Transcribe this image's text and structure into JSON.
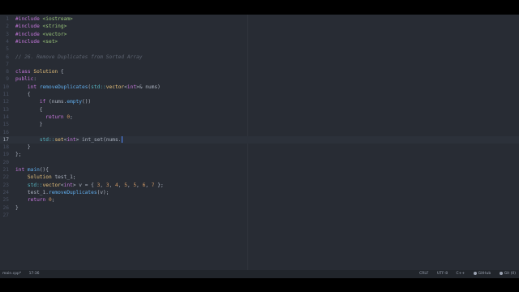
{
  "editor": {
    "lines": [
      {
        "n": "1",
        "segs": [
          {
            "t": "#include ",
            "c": "tok-pp"
          },
          {
            "t": "<iostream>",
            "c": "tok-inc"
          }
        ]
      },
      {
        "n": "2",
        "segs": [
          {
            "t": "#include ",
            "c": "tok-pp"
          },
          {
            "t": "<string>",
            "c": "tok-inc"
          }
        ]
      },
      {
        "n": "3",
        "segs": [
          {
            "t": "#include ",
            "c": "tok-pp"
          },
          {
            "t": "<vector>",
            "c": "tok-inc"
          }
        ]
      },
      {
        "n": "4",
        "segs": [
          {
            "t": "#include ",
            "c": "tok-pp"
          },
          {
            "t": "<set>",
            "c": "tok-inc"
          }
        ]
      },
      {
        "n": "5",
        "segs": []
      },
      {
        "n": "6",
        "segs": [
          {
            "t": "// 26. Remove Duplicates from Sorted Array",
            "c": "tok-cm"
          }
        ]
      },
      {
        "n": "7",
        "segs": []
      },
      {
        "n": "8",
        "segs": [
          {
            "t": "class ",
            "c": "tok-kw"
          },
          {
            "t": "Solution",
            "c": "tok-ty"
          },
          {
            "t": " {",
            "c": ""
          }
        ]
      },
      {
        "n": "9",
        "segs": [
          {
            "t": "public",
            "c": "tok-kw"
          },
          {
            "t": ":",
            "c": ""
          }
        ]
      },
      {
        "n": "10",
        "segs": [
          {
            "t": "    ",
            "c": ""
          },
          {
            "t": "int ",
            "c": "tok-kw"
          },
          {
            "t": "removeDuplicates",
            "c": "tok-fn"
          },
          {
            "t": "(",
            "c": ""
          },
          {
            "t": "std::",
            "c": "tok-ns"
          },
          {
            "t": "vector",
            "c": "tok-ty"
          },
          {
            "t": "<",
            "c": ""
          },
          {
            "t": "int",
            "c": "tok-kw"
          },
          {
            "t": ">& nums)",
            "c": ""
          }
        ]
      },
      {
        "n": "11",
        "segs": [
          {
            "t": "    {",
            "c": ""
          }
        ]
      },
      {
        "n": "12",
        "segs": [
          {
            "t": "        ",
            "c": ""
          },
          {
            "t": "if ",
            "c": "tok-kw"
          },
          {
            "t": "(nums.",
            "c": ""
          },
          {
            "t": "empty",
            "c": "tok-fn"
          },
          {
            "t": "())",
            "c": ""
          }
        ]
      },
      {
        "n": "13",
        "segs": [
          {
            "t": "        {",
            "c": ""
          }
        ]
      },
      {
        "n": "14",
        "segs": [
          {
            "t": "          ",
            "c": ""
          },
          {
            "t": "return ",
            "c": "tok-kw"
          },
          {
            "t": "0",
            "c": "tok-num"
          },
          {
            "t": ";",
            "c": ""
          }
        ]
      },
      {
        "n": "15",
        "segs": [
          {
            "t": "        }",
            "c": ""
          }
        ]
      },
      {
        "n": "16",
        "segs": []
      },
      {
        "n": "17",
        "segs": [
          {
            "t": "        ",
            "c": ""
          },
          {
            "t": "std::",
            "c": "tok-ns"
          },
          {
            "t": "set",
            "c": "tok-ty"
          },
          {
            "t": "<",
            "c": ""
          },
          {
            "t": "int",
            "c": "tok-kw"
          },
          {
            "t": "> int_set(nums.",
            "c": ""
          }
        ],
        "active": true,
        "cursor": true
      },
      {
        "n": "18",
        "segs": [
          {
            "t": "    }",
            "c": ""
          }
        ]
      },
      {
        "n": "19",
        "segs": [
          {
            "t": "};",
            "c": ""
          }
        ]
      },
      {
        "n": "20",
        "segs": []
      },
      {
        "n": "21",
        "segs": [
          {
            "t": "int ",
            "c": "tok-kw"
          },
          {
            "t": "main",
            "c": "tok-fn"
          },
          {
            "t": "(){",
            "c": ""
          }
        ]
      },
      {
        "n": "22",
        "segs": [
          {
            "t": "    ",
            "c": ""
          },
          {
            "t": "Solution",
            "c": "tok-ty"
          },
          {
            "t": " test_1;",
            "c": ""
          }
        ]
      },
      {
        "n": "23",
        "segs": [
          {
            "t": "    ",
            "c": ""
          },
          {
            "t": "std::",
            "c": "tok-ns"
          },
          {
            "t": "vector",
            "c": "tok-ty"
          },
          {
            "t": "<",
            "c": ""
          },
          {
            "t": "int",
            "c": "tok-kw"
          },
          {
            "t": "> v = { ",
            "c": ""
          },
          {
            "t": "3",
            "c": "tok-num"
          },
          {
            "t": ", ",
            "c": ""
          },
          {
            "t": "3",
            "c": "tok-num"
          },
          {
            "t": ", ",
            "c": ""
          },
          {
            "t": "4",
            "c": "tok-num"
          },
          {
            "t": ", ",
            "c": ""
          },
          {
            "t": "5",
            "c": "tok-num"
          },
          {
            "t": ", ",
            "c": ""
          },
          {
            "t": "5",
            "c": "tok-num"
          },
          {
            "t": ", ",
            "c": ""
          },
          {
            "t": "6",
            "c": "tok-num"
          },
          {
            "t": ", ",
            "c": ""
          },
          {
            "t": "7",
            "c": "tok-num"
          },
          {
            "t": " };",
            "c": ""
          }
        ]
      },
      {
        "n": "24",
        "segs": [
          {
            "t": "    test_1.",
            "c": ""
          },
          {
            "t": "removeDuplicates",
            "c": "tok-fn"
          },
          {
            "t": "(v);",
            "c": ""
          }
        ]
      },
      {
        "n": "25",
        "segs": [
          {
            "t": "    ",
            "c": ""
          },
          {
            "t": "return ",
            "c": "tok-kw"
          },
          {
            "t": "0",
            "c": "tok-num"
          },
          {
            "t": ";",
            "c": ""
          }
        ]
      },
      {
        "n": "26",
        "segs": [
          {
            "t": "}",
            "c": ""
          }
        ]
      },
      {
        "n": "27",
        "segs": []
      }
    ]
  },
  "status": {
    "file_name": "main.cpp*",
    "cursor_pos": "17:36",
    "line_ending": "CRLF",
    "encoding": "UTF-8",
    "grammar": "C++",
    "github_label": "GitHub",
    "git_label": "Git (0)"
  },
  "colors": {
    "background": "#282c34",
    "statusbar": "#21252b",
    "accent_cursor": "#528bff"
  }
}
